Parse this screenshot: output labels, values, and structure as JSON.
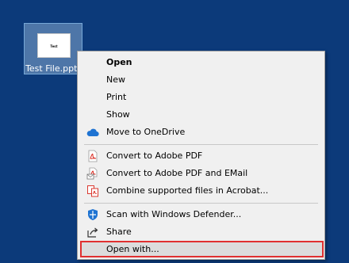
{
  "desktop": {
    "file_name": "Test File.pptx",
    "thumbnail_text": "Test"
  },
  "menu": {
    "items": [
      {
        "label": "Open",
        "icon": "none",
        "bold": true
      },
      {
        "label": "New",
        "icon": "none"
      },
      {
        "label": "Print",
        "icon": "none"
      },
      {
        "label": "Show",
        "icon": "none"
      },
      {
        "label": "Move to OneDrive",
        "icon": "onedrive-cloud-icon"
      },
      {
        "label": "Convert to Adobe PDF",
        "icon": "adobe-pdf-icon"
      },
      {
        "label": "Convert to Adobe PDF and EMail",
        "icon": "adobe-pdf-email-icon"
      },
      {
        "label": "Combine supported files in Acrobat...",
        "icon": "acrobat-combine-icon"
      },
      {
        "label": "Scan with Windows Defender...",
        "icon": "windows-defender-icon"
      },
      {
        "label": "Share",
        "icon": "share-icon"
      },
      {
        "label": "Open with...",
        "icon": "none",
        "highlighted": true
      }
    ]
  },
  "colors": {
    "desktop_bg": "#0c3a7a",
    "menu_bg": "#f0f0f0",
    "highlight_border": "#e03030",
    "onedrive_blue": "#1e73d2",
    "adobe_red": "#d8261c"
  }
}
